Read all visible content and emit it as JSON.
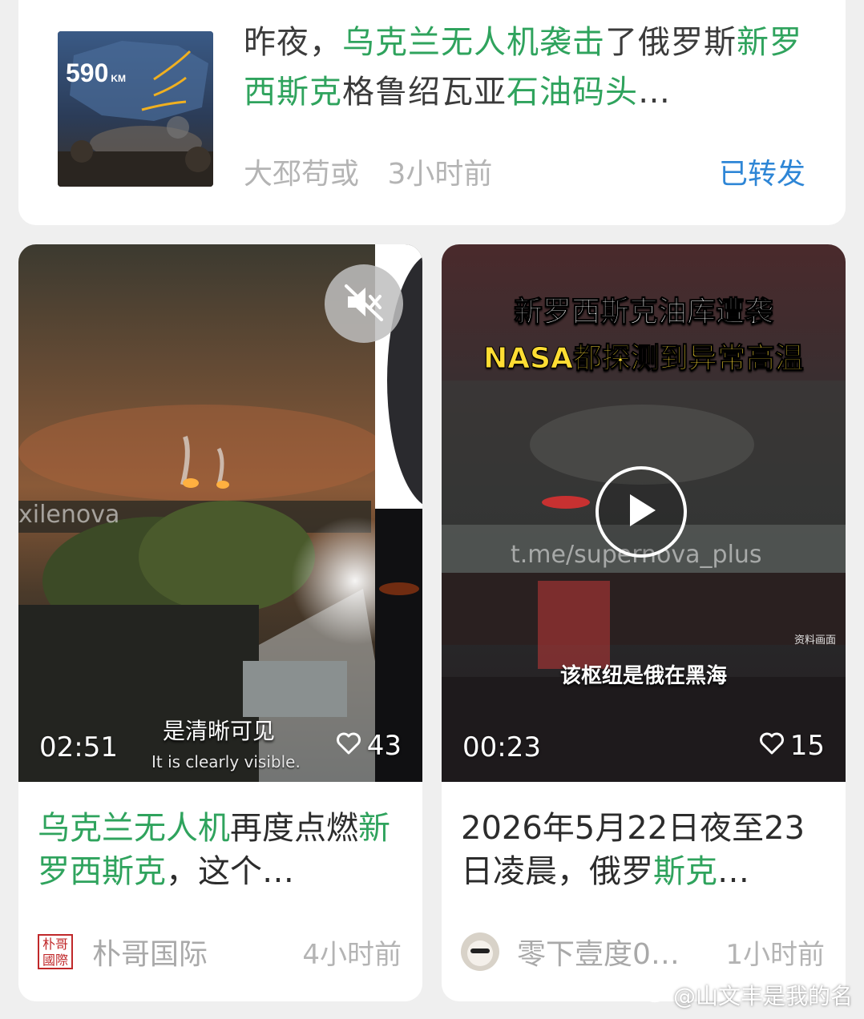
{
  "top_post": {
    "thumb_badge": "590",
    "thumb_unit": "KM",
    "title_parts": [
      {
        "text": "昨夜，",
        "hl": false
      },
      {
        "text": "乌克兰无人机袭击",
        "hl": true
      },
      {
        "text": "了俄罗斯",
        "hl": false
      },
      {
        "text": "新罗西斯克",
        "hl": true
      },
      {
        "text": "格鲁绍瓦亚",
        "hl": false
      },
      {
        "text": "石油码头",
        "hl": true
      },
      {
        "text": "…",
        "hl": false
      }
    ],
    "author": "大邳苟或",
    "time": "3小时前",
    "repost_label": "已转发"
  },
  "cards": [
    {
      "duration": "02:51",
      "likes": "43",
      "subtitle_zh": "是清晰可见",
      "subtitle_en": "It is clearly visible.",
      "overlay_watermark": "xilenova",
      "caption_parts": [
        {
          "text": "乌克兰无人机",
          "hl": true
        },
        {
          "text": "再度点燃",
          "hl": false
        },
        {
          "text": "新罗西斯克",
          "hl": true
        },
        {
          "text": "，这个…",
          "hl": false
        }
      ],
      "author_icon_text": "朴哥國際",
      "author": "朴哥国际",
      "time": "4小时前"
    },
    {
      "duration": "00:23",
      "likes": "15",
      "headline_1": "新罗西斯克油库遭袭",
      "headline_2": "NASA都探测到异常高温",
      "overlay_watermark": "t.me/supernova_plus",
      "source_tag": "资料画面",
      "subtitle_zh": "该枢纽是俄在黑海",
      "caption_parts": [
        {
          "text": "2026年5月22日夜至23日凌晨，俄罗",
          "hl": false
        },
        {
          "text": "斯克",
          "hl": true
        },
        {
          "text": "…",
          "hl": false
        }
      ],
      "author": "零下壹度0…",
      "time": "1小时前"
    }
  ],
  "page_watermark": "@山文丰是我的名",
  "colors": {
    "highlight": "#2fa35d",
    "repost": "#2e86d6",
    "background": "#efefef"
  },
  "icons": [
    "mute-icon",
    "play-icon",
    "heart-icon",
    "weibo-icon"
  ]
}
